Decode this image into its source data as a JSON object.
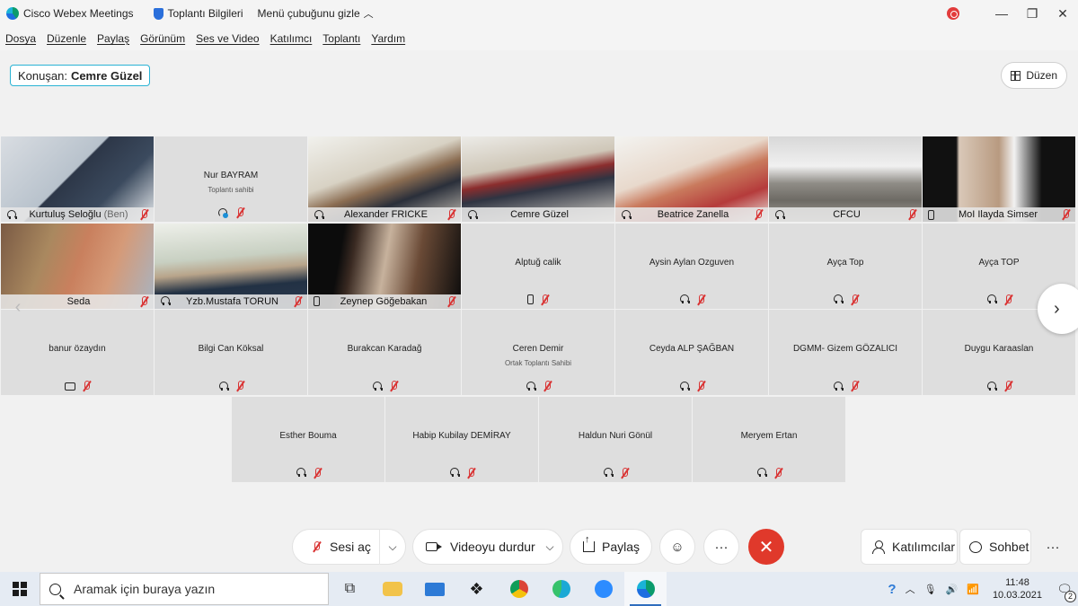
{
  "titlebar": {
    "app_title": "Cisco Webex Meetings",
    "meeting_info": "Toplantı Bilgileri",
    "hide_menu": "Menü çubuğunu gizle"
  },
  "menu": [
    "Dosya",
    "Düzenle",
    "Paylaş",
    "Görünüm",
    "Ses ve Video",
    "Katılımcı",
    "Toplantı",
    "Yardım"
  ],
  "speaker": {
    "label": "Konuşan:",
    "name": "Cemre Güzel"
  },
  "layout_button": "Düzen",
  "tiles": [
    {
      "name": "Kurtuluş Seloğlu",
      "tag": "(Ben)",
      "video": true,
      "left": "headset",
      "mic_off": true
    },
    {
      "name": "Nur BAYRAM",
      "role": "Toplantı sahibi",
      "video": false,
      "left": "headset-blue",
      "mic_off": true
    },
    {
      "name": "Alexander FRICKE",
      "video": true,
      "left": "headset",
      "mic_off": true
    },
    {
      "name": "Cemre Güzel",
      "video": true,
      "left": "headset",
      "mic_off": false,
      "active": true
    },
    {
      "name": "Beatrice Zanella",
      "video": true,
      "left": "headset",
      "mic_off": true
    },
    {
      "name": "CFCU",
      "video": true,
      "left": "headset",
      "mic_off": true
    },
    {
      "name": "MoI Ilayda Simser",
      "video": true,
      "left": "phone",
      "mic_off": true
    },
    {
      "name": "Seda",
      "video": true,
      "left": "",
      "mic_off": true
    },
    {
      "name": "Yzb.Mustafa TORUN",
      "video": true,
      "left": "headset",
      "mic_off": true
    },
    {
      "name": "Zeynep Göğebakan",
      "video": true,
      "left": "phone",
      "mic_off": true
    },
    {
      "name": "Alptuğ calik",
      "video": false,
      "left": "phone",
      "mic_off": true
    },
    {
      "name": "Aysin Aylan Ozguven",
      "video": false,
      "left": "headset",
      "mic_off": true
    },
    {
      "name": "Ayça Top",
      "video": false,
      "left": "headset",
      "mic_off": true
    },
    {
      "name": "Ayça TOP",
      "video": false,
      "left": "headset",
      "mic_off": true
    },
    {
      "name": "banur özaydın",
      "video": false,
      "left": "screen",
      "mic_off": true
    },
    {
      "name": "Bilgi Can Köksal",
      "video": false,
      "left": "headset",
      "mic_off": true
    },
    {
      "name": "Burakcan Karadağ",
      "video": false,
      "left": "headset",
      "mic_off": true
    },
    {
      "name": "Ceren Demir",
      "role": "Ortak Toplantı Sahibi",
      "video": false,
      "left": "headset",
      "mic_off": true
    },
    {
      "name": "Ceyda ALP ŞAĞBAN",
      "video": false,
      "left": "headset",
      "mic_off": true
    },
    {
      "name": "DGMM- Gizem GÖZALICI",
      "video": false,
      "left": "headset",
      "mic_off": true
    },
    {
      "name": "Duygu Karaaslan",
      "video": false,
      "left": "headset",
      "mic_off": true
    },
    {
      "name": "Esther Bouma",
      "video": false,
      "left": "headset",
      "mic_off": true
    },
    {
      "name": "Habip Kubilay DEMİRAY",
      "video": false,
      "left": "headset",
      "mic_off": true
    },
    {
      "name": "Haldun Nuri Gönül",
      "video": false,
      "left": "headset",
      "mic_off": true
    },
    {
      "name": "Meryem Ertan",
      "video": false,
      "left": "headset",
      "mic_off": true
    }
  ],
  "controls": {
    "unmute": "Sesi aç",
    "stop_video": "Videoyu durdur",
    "share": "Paylaş",
    "participants": "Katılımcılar",
    "chat": "Sohbet"
  },
  "taskbar": {
    "search_placeholder": "Aramak için buraya yazın",
    "time": "11:48",
    "date": "10.03.2021",
    "notifications": "2"
  },
  "colors": {
    "active_tile_border": "#27b3dc",
    "end_button": "#e0392b",
    "mic_off": "#d93333"
  }
}
